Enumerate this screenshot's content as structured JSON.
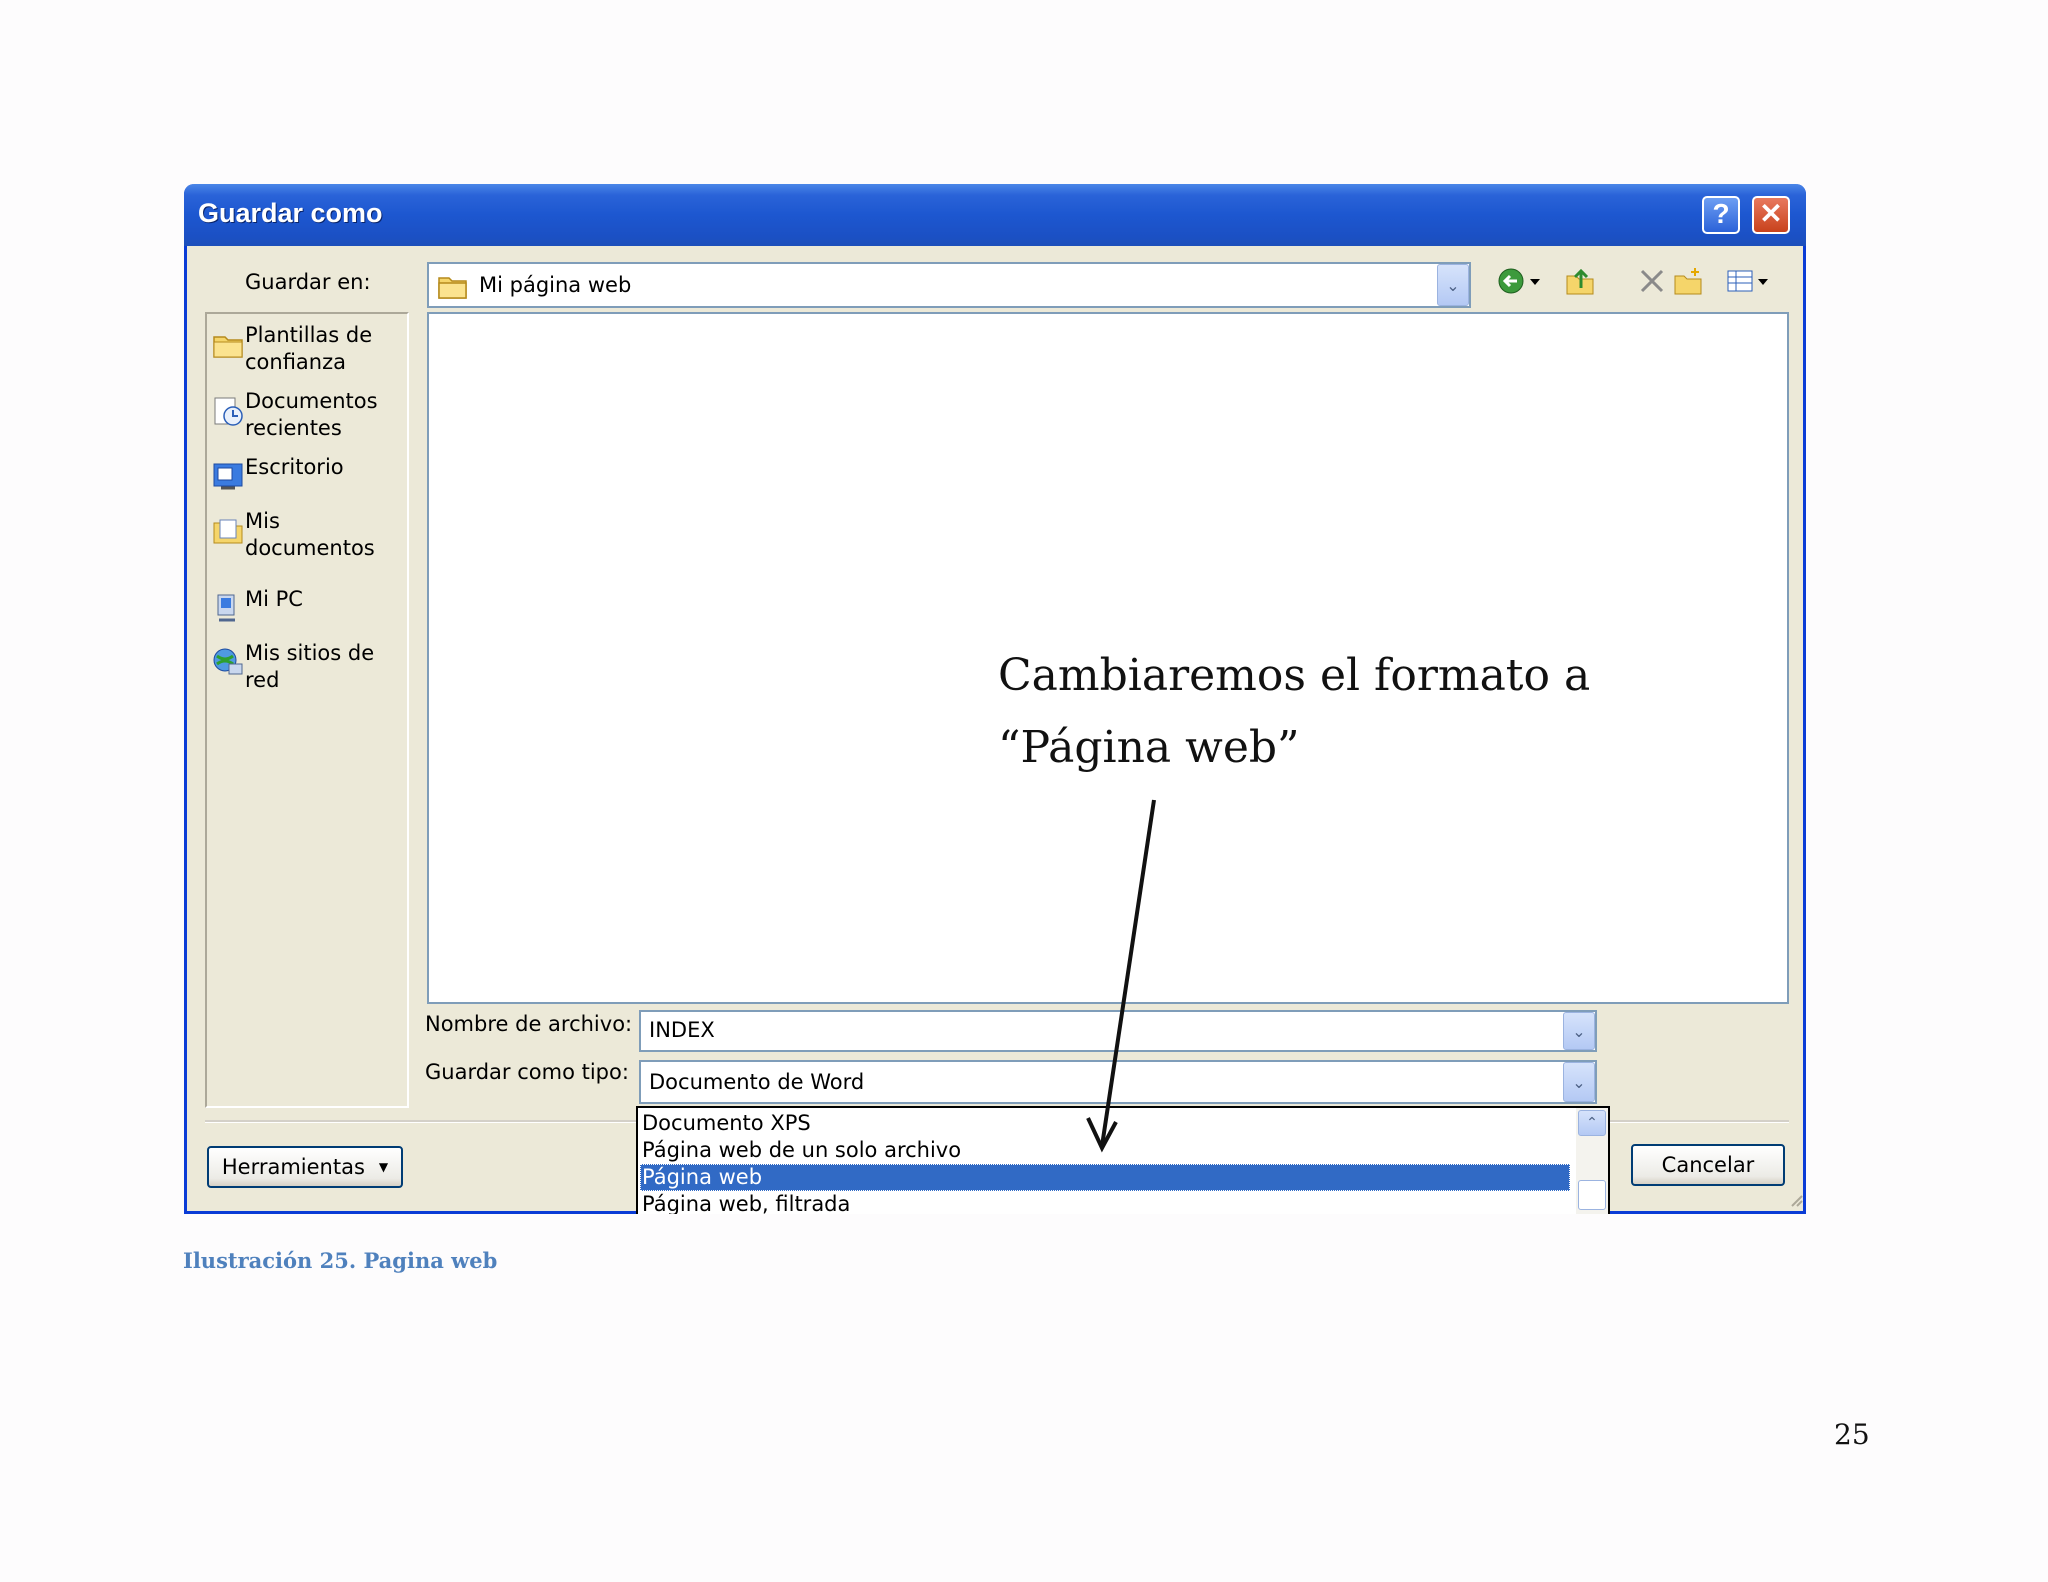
{
  "dialog": {
    "title": "Guardar como",
    "help_glyph": "?",
    "close_glyph": "✕",
    "save_in_label": "Guardar en:",
    "save_in_value": "Mi página web",
    "filename_label": "Nombre de archivo:",
    "filename_value": "INDEX",
    "filetype_label": "Guardar como tipo:",
    "filetype_value": "Documento de Word",
    "filetype_options": [
      "Documento XPS",
      "Página web de un solo archivo",
      "Página web",
      "Página web, filtrada"
    ],
    "selected_option": "Página web",
    "tools_button": "Herramientas",
    "cancel_button": "Cancelar"
  },
  "places": [
    {
      "label": "Plantillas de confianza",
      "icon": "folder-icon"
    },
    {
      "label": "Documentos recientes",
      "icon": "recent-documents-icon"
    },
    {
      "label": "Escritorio",
      "icon": "desktop-icon"
    },
    {
      "label": "Mis documentos",
      "icon": "my-documents-icon"
    },
    {
      "label": "Mi PC",
      "icon": "computer-icon"
    },
    {
      "label": "Mis sitios de red",
      "icon": "network-icon"
    }
  ],
  "annotation": {
    "line1": "Cambiaremos el formato a",
    "line2": "“Página web”"
  },
  "caption": "Ilustración 25. Pagina web",
  "page_number": "25",
  "colors": {
    "titlebar": "#1d57d0",
    "selection": "#316ac5",
    "caption": "#4f81bd"
  }
}
